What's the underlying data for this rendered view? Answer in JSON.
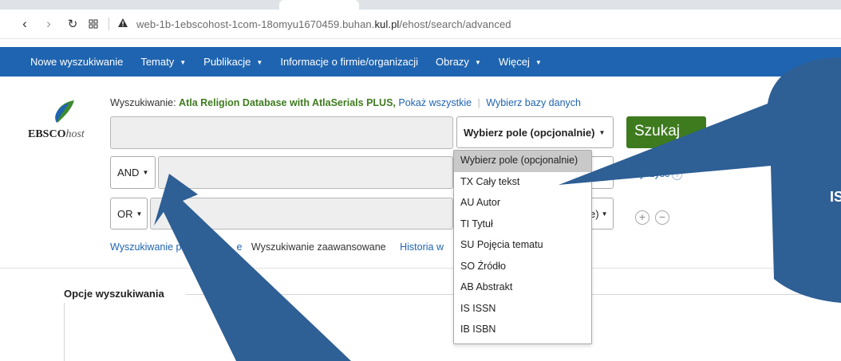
{
  "browser": {
    "url_prefix": "web-1b-1ebscohost-1com-18omyu1670459.buhan.",
    "url_domain": "kul.pl",
    "url_path": "/ehost/search/advanced"
  },
  "nav": {
    "items": [
      "Nowe wyszukiwanie",
      "Tematy",
      "Publikacje",
      "Informacje o firmie/organizacji",
      "Obrazy",
      "Więcej"
    ]
  },
  "logo": {
    "text_bold": "EBSCO",
    "text_italic": "host"
  },
  "search": {
    "label": "Wyszukiwanie:",
    "database": "Atla Religion Database with AtlaSerials PLUS,",
    "show_all": "Pokaż wszystkie",
    "choose_db": "Wybierz bazy danych",
    "field_select_label": "Wybierz pole (opcjonalnie)",
    "row3_select_partial": "e)",
    "bool_row2": "AND",
    "bool_row3": "OR",
    "search_button": "Szukaj",
    "clear_partial": "Wyczyść"
  },
  "links": {
    "basic_partial": "Wyszukiwanie po",
    "basic_tail": "e",
    "advanced": "Wyszukiwanie zaawansowane",
    "history": "Historia w"
  },
  "options": {
    "title": "Opcje wyszukiwania"
  },
  "dropdown": {
    "options": [
      "Wybierz pole (opcjonalnie)",
      "TX Cały tekst",
      "AU Autor",
      "TI Tytuł",
      "SU Pojęcia tematu",
      "SO Źródło",
      "AB Abstrakt",
      "IS ISSN",
      "IB ISBN"
    ]
  },
  "annotation": {
    "callout_text": "IS"
  },
  "colors": {
    "nav_blue": "#1f64b0",
    "search_green": "#3e7b1f",
    "annotation_blue": "#2e5f95"
  }
}
